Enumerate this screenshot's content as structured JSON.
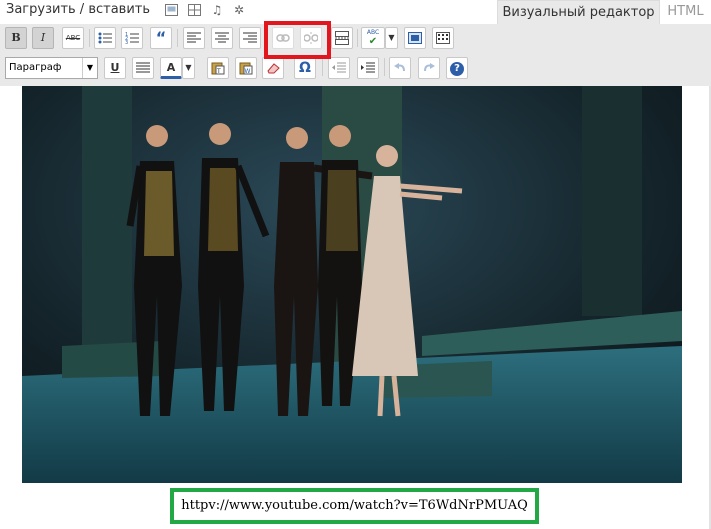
{
  "header": {
    "upload_label": "Загрузить / вставить",
    "media_icons": [
      "image-icon",
      "gallery-icon",
      "music-icon",
      "star-icon"
    ],
    "tabs": [
      {
        "label": "Визуальный редактор",
        "active": true
      },
      {
        "label": "HTML",
        "active": false
      }
    ]
  },
  "toolbar1": {
    "bold": "B",
    "italic": "I",
    "strike": "ABC",
    "quote": "“",
    "spell": "ABC"
  },
  "toolbar2": {
    "format_select": "Параграф",
    "underline": "U",
    "text_color": "A",
    "special_char": "Ω",
    "help": "?"
  },
  "content": {
    "url_text": "httpv://www.youtube.com/watch?v=T6WdNrPMUAQ"
  },
  "colors": {
    "highlight_red": "#e4161d",
    "highlight_green": "#22a845",
    "toolbar_bg": "#e9e9e9"
  }
}
